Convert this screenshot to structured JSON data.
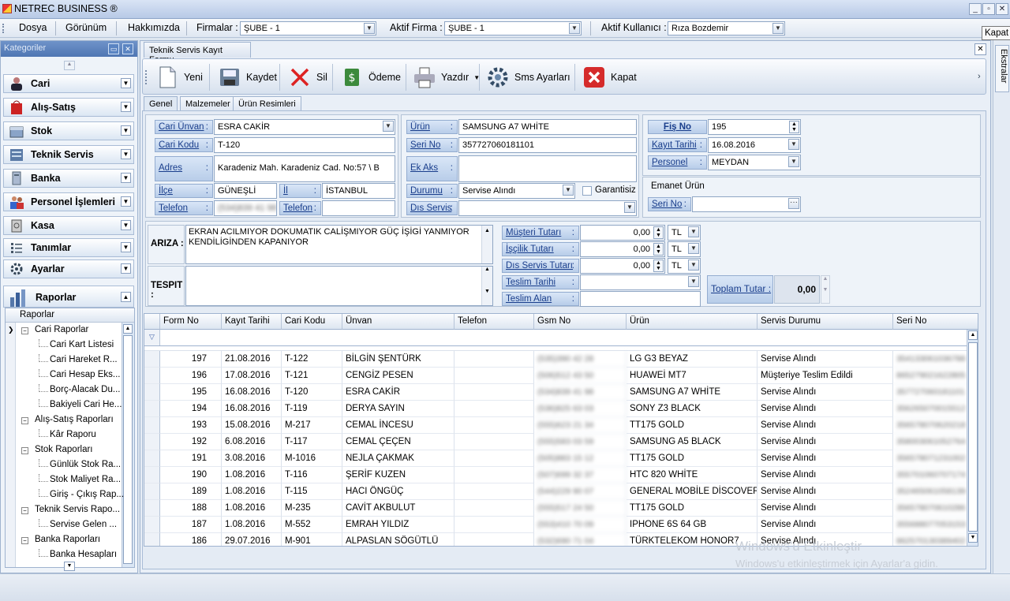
{
  "app": {
    "title": "NETREC BUSINESS ®",
    "tooltip": "Kapat"
  },
  "menu": {
    "dosya": "Dosya",
    "gorunum": "Görünüm",
    "hakkimizda": "Hakkımızda",
    "firmalar_label": "Firmalar :",
    "firmalar_value": "ŞUBE - 1",
    "aktif_firma_label": "Aktif Firma :",
    "aktif_firma_value": "ŞUBE - 1",
    "aktif_kullanici_label": "Aktif Kullanıcı :",
    "aktif_kullanici_value": "Rıza Bozdemir"
  },
  "left": {
    "header": "Kategoriler",
    "nav": [
      "Cari",
      "Alış-Satış",
      "Stok",
      "Teknik Servis",
      "Banka",
      "Personel İşlemleri",
      "Kasa",
      "Tanımlar",
      "Ayarlar",
      "Raporlar"
    ],
    "tree_header": "Raporlar",
    "tree": [
      {
        "label": "Cari Raporlar",
        "level": 0
      },
      {
        "label": "Cari Kart Listesi",
        "level": 1
      },
      {
        "label": "Cari Hareket R...",
        "level": 1
      },
      {
        "label": "Cari Hesap Eks...",
        "level": 1
      },
      {
        "label": "Borç-Alacak Du...",
        "level": 1
      },
      {
        "label": "Bakiyeli Cari He...",
        "level": 1
      },
      {
        "label": "Alış-Satış Raporları",
        "level": 0
      },
      {
        "label": "Kâr Raporu",
        "level": 1
      },
      {
        "label": "Stok Raporları",
        "level": 0
      },
      {
        "label": "Günlük Stok Ra...",
        "level": 1
      },
      {
        "label": "Stok Maliyet Ra...",
        "level": 1
      },
      {
        "label": "Giriş - Çıkış Rap...",
        "level": 1
      },
      {
        "label": "Teknik Servis Rapo...",
        "level": 0
      },
      {
        "label": "Servise Gelen ...",
        "level": 1
      },
      {
        "label": "Banka Raporları",
        "level": 0
      },
      {
        "label": "Banka Hesapları",
        "level": 1
      }
    ]
  },
  "right_strip": {
    "label": "Ekstralar"
  },
  "doc": {
    "tab": "Teknik Servis Kayıt Formu"
  },
  "toolbar": {
    "yeni": "Yeni",
    "kaydet": "Kaydet",
    "sil": "Sil",
    "odeme": "Ödeme",
    "yazdir": "Yazdır",
    "sms": "Sms Ayarları",
    "kapat": "Kapat"
  },
  "tabs": [
    "Genel",
    "Malzemeler",
    "Ürün Resimleri"
  ],
  "form": {
    "cari_unvan_label": "Cari Ünvan",
    "cari_unvan": "ESRA CAKİR",
    "cari_kodu_label": "Cari Kodu",
    "cari_kodu": "T-120",
    "adres_label": "Adres",
    "adres": "Karadeniz Mah. Karadeniz Cad. No:57 \\ B",
    "ilce_label": "İlçe",
    "ilce": "GÜNEŞLİ",
    "il_label": "İl",
    "il": "İSTANBUL",
    "telefon_label": "Telefon",
    "telefon": "(534)839 41 98",
    "telefon2_label": "Telefon",
    "urun_label": "Ürün",
    "urun": "SAMSUNG A7 WHİTE",
    "seri_no_label": "Seri No",
    "seri_no": "357727060181101",
    "ek_aks_label": "Ek Aks",
    "durumu_label": "Durumu",
    "durumu": "Servise Alındı",
    "garantisiz": "Garantisiz",
    "dis_servis_label": "Dıs Servis",
    "fis_no_label": "Fiş No",
    "fis_no": "195",
    "kayit_tarihi_label": "Kayıt Tarihi",
    "kayit_tarihi": "16.08.2016",
    "personel_label": "Personel",
    "personel": "MEYDAN",
    "emanet_urun": "Emanet Ürün",
    "emanet_seri_label": "Seri No",
    "ariza_label": "ARIZA :",
    "ariza": "EKRAN ACILMIYOR DOKUMATIK CALİŞMIYOR GÜÇ İŞİGİ YANMIYOR KENDİLİGİNDEN KAPANIYOR",
    "tespit_label": "TESPIT :",
    "musteri_tutari_label": "Müşteri Tutarı",
    "musteri_tutari": "0,00",
    "iscilik_tutari_label": "İşçilik Tutarı",
    "iscilik_tutari": "0,00",
    "dis_servis_tutari_label": "Dıs Servis Tutarı",
    "dis_servis_tutari": "0,00",
    "currency": "TL",
    "teslim_tarihi_label": "Teslim Tarihi",
    "teslim_alan_label": "Teslim Alan",
    "toplam_tutar_label": "Toplam Tutar :",
    "toplam_tutar": "0,00"
  },
  "grid": {
    "columns": [
      "Form No",
      "Kayıt Tarihi",
      "Cari Kodu",
      "Ünvan",
      "Telefon",
      "Gsm No",
      "Ürün",
      "Servis Durumu",
      "Seri No"
    ],
    "rows": [
      [
        "197",
        "21.08.2016",
        "T-122",
        "BİLGİN ŞENTÜRK",
        "",
        "(535)390 42 28",
        "LG G3 BEYAZ",
        "Servise Alındı",
        "354133061036788"
      ],
      [
        "196",
        "17.08.2016",
        "T-121",
        "CENGİZ PESEN",
        "",
        "(506)512 43 50",
        "HUAWEİ MT7",
        "Müşteriye Teslim Edildi",
        "865279021622805"
      ],
      [
        "195",
        "16.08.2016",
        "T-120",
        "ESRA CAKİR",
        "",
        "(534)839 41 98",
        "SAMSUNG A7 WHİTE",
        "Servise Alındı",
        "357727060181101"
      ],
      [
        "194",
        "16.08.2016",
        "T-119",
        "DERYA SAYIN",
        "",
        "(536)825 63 03",
        "SONY Z3 BLACK",
        "Servise Alındı",
        "356265070015512"
      ],
      [
        "193",
        "15.08.2016",
        "M-217",
        "CEMAL İNCESU",
        "",
        "(555)623 21 34",
        "TT175 GOLD",
        "Servise Alındı",
        "356578070620218"
      ],
      [
        "192",
        "6.08.2016",
        "T-117",
        "CEMAL ÇEÇEN",
        "",
        "(555)583 03 59",
        "SAMSUNG A5 BLACK",
        "Servise Alındı",
        "358003061052764"
      ],
      [
        "191",
        "3.08.2016",
        "M-1016",
        "NEJLA ÇAKMAK",
        "",
        "(505)883 15 12",
        "TT175 GOLD",
        "Servise Alındı",
        "356578071231002"
      ],
      [
        "190",
        "1.08.2016",
        "T-116",
        "ŞERİF KUZEN",
        "",
        "(507)699 32 37",
        "HTC 820 WHİTE",
        "Servise Alındı",
        "355701060707174"
      ],
      [
        "189",
        "1.08.2016",
        "T-115",
        "HACI ÖNGÜÇ",
        "",
        "(544)229 90 07",
        "GENERAL MOBİLE DİSCOVERY 2",
        "Servise Alındı",
        "352465061058139"
      ],
      [
        "188",
        "1.08.2016",
        "M-235",
        "CAVİT AKBULUT",
        "",
        "(555)517 24 50",
        "TT175 GOLD",
        "Servise Alındı",
        "356578070610286"
      ],
      [
        "187",
        "1.08.2016",
        "M-552",
        "EMRAH YILDIZ",
        "",
        "(553)410 70 09",
        "IPHONE 6S 64 GB",
        "Servise Alındı",
        "355688077053153"
      ],
      [
        "186",
        "29.07.2016",
        "M-901",
        "ALPASLAN SÖGÜTLÜ",
        "",
        "(532)690 71 04",
        "TÜRKTELEKOM HONOR7",
        "Servise Alındı",
        "862570130389402"
      ]
    ]
  },
  "watermark": {
    "line1": "Windows'u Etkinleştir",
    "line2": "Windows'u etkinleştirmek için Ayarlar'a gidin."
  },
  "colors": {
    "accent": "#4f76b3",
    "label_bg": "#c8d9f0",
    "label_text": "#1a3e8c"
  }
}
